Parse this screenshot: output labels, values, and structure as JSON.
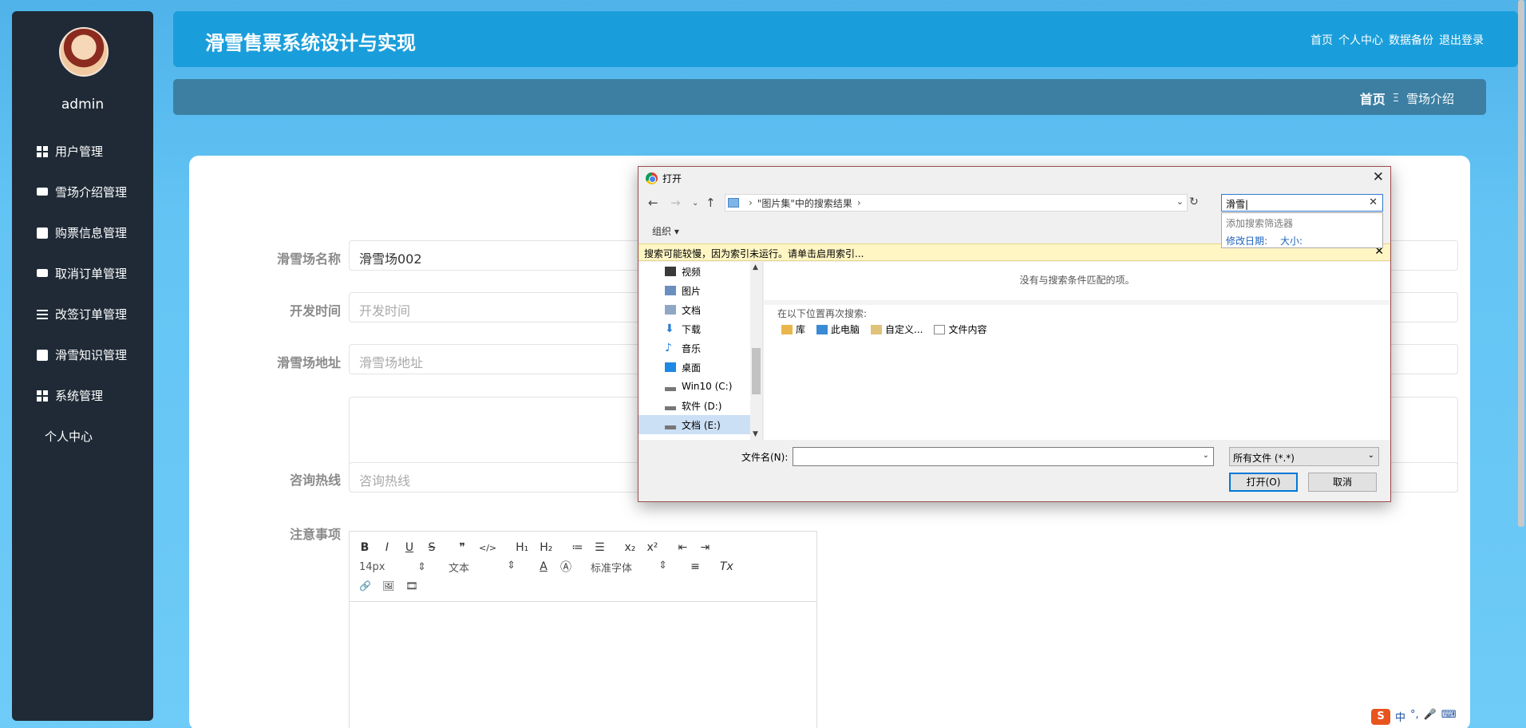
{
  "sidebar": {
    "username": "admin",
    "items": [
      {
        "label": "用户管理",
        "icon": "grid-icon"
      },
      {
        "label": "雪场介绍管理",
        "icon": "monitor-icon"
      },
      {
        "label": "购票信息管理",
        "icon": "clipboard-icon"
      },
      {
        "label": "取消订单管理",
        "icon": "monitor-icon"
      },
      {
        "label": "改签订单管理",
        "icon": "sliders-icon"
      },
      {
        "label": "滑雪知识管理",
        "icon": "clipboard-icon"
      },
      {
        "label": "系统管理",
        "icon": "grid-icon"
      },
      {
        "label": "个人中心",
        "icon": "card-icon"
      }
    ]
  },
  "header": {
    "title": "滑雪售票系统设计与实现",
    "links": [
      "首页",
      "个人中心",
      "数据备份",
      "退出登录"
    ]
  },
  "breadcrumb": {
    "home": "首页",
    "separator": "Ξ",
    "current": "雪场介绍"
  },
  "form": {
    "name_label": "滑雪场名称",
    "name_value": "滑雪场002",
    "open_time_label": "开发时间",
    "open_time_placeholder": "开发时间",
    "address_label": "滑雪场地址",
    "address_placeholder": "滑雪场地址",
    "hotline_label": "咨询热线",
    "hotline_placeholder": "咨询热线",
    "notes_label": "注意事项"
  },
  "editor": {
    "row1": [
      "B",
      "I",
      "U",
      "S",
      "❞",
      "</>",
      "H₁",
      "H₂",
      "≔",
      "☰",
      "x₂",
      "x²",
      "⇤",
      "⇥"
    ],
    "font_size": "14px",
    "block_type": "文本",
    "font_family": "标准字体",
    "row3": [
      "🔗",
      "🖼",
      "🎞"
    ]
  },
  "dialog": {
    "title": "打开",
    "address_text": "\"图片集\"中的搜索结果",
    "search_value": "滑雪",
    "suggestion_hint": "添加搜索筛选器",
    "suggestion_links": [
      "修改日期:",
      "大小:"
    ],
    "organize": "组织 ▾",
    "notice": "搜索可能较慢，因为索引未运行。请单击启用索引...",
    "nav_items": [
      {
        "label": "视频",
        "icon": "video-icon",
        "color": "#3a3a3a"
      },
      {
        "label": "图片",
        "icon": "pictures-icon",
        "color": "#6a8fbf"
      },
      {
        "label": "文档",
        "icon": "documents-icon",
        "color": "#8fa7c4"
      },
      {
        "label": "下载",
        "icon": "download-icon",
        "color": "#2a7fd4"
      },
      {
        "label": "音乐",
        "icon": "music-icon",
        "color": "#2a7fd4"
      },
      {
        "label": "桌面",
        "icon": "desktop-icon",
        "color": "#1e88e5"
      },
      {
        "label": "Win10 (C:)",
        "icon": "drive-c-icon",
        "color": "#777777"
      },
      {
        "label": "软件 (D:)",
        "icon": "drive-d-icon",
        "color": "#777777"
      },
      {
        "label": "文档 (E:)",
        "icon": "drive-e-icon",
        "color": "#777777"
      }
    ],
    "no_match": "没有与搜索条件匹配的项。",
    "search_again_label": "在以下位置再次搜索:",
    "search_again_links": [
      "库",
      "此电脑",
      "自定义...",
      "文件内容"
    ],
    "filename_label": "文件名(N):",
    "filename_value": "",
    "file_type": "所有文件 (*.*)",
    "open_button": "打开(O)",
    "cancel_button": "取消"
  },
  "taskbar_ime": [
    "中",
    "°,",
    "🎤",
    "⌨"
  ]
}
